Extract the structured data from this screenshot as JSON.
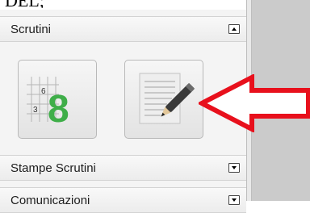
{
  "top_fragment": "DEL;",
  "sections": [
    {
      "label": "Scrutini",
      "toggle": "collapse-icon"
    },
    {
      "label": "Stampe Scrutini",
      "toggle": "expand-icon"
    },
    {
      "label": "Comunicazioni",
      "toggle": "expand-icon"
    }
  ],
  "tiles": [
    {
      "icon": "grades-grid-icon",
      "digits": [
        "6",
        "3"
      ],
      "big_digit": "8"
    },
    {
      "icon": "edit-document-icon"
    }
  ],
  "colors": {
    "arrow": "#e8101c",
    "grade_green": "#3fae49",
    "panel_bg": "#f4f4f4",
    "right_area": "#cbcbcb"
  }
}
